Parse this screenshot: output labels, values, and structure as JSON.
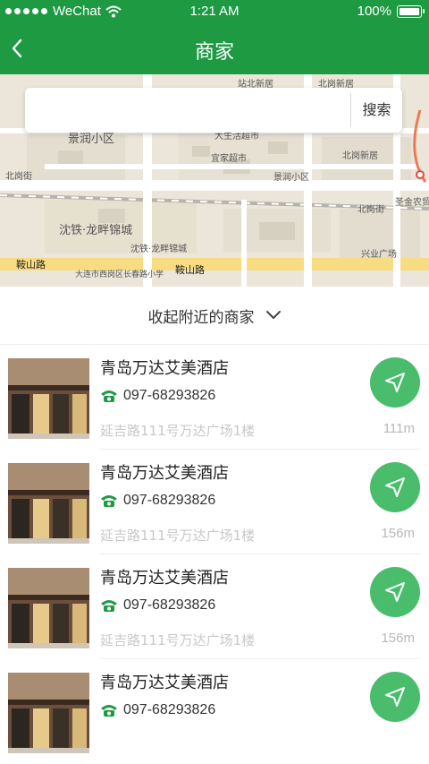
{
  "status": {
    "carrier": "WeChat",
    "time": "1:21 AM",
    "battery": "100%"
  },
  "nav": {
    "title": "商家",
    "back_icon": "chevron-left-icon"
  },
  "search": {
    "placeholder": "",
    "button": "搜索"
  },
  "map": {
    "labels": [
      "景润小区",
      "大生活超市",
      "宜家超市",
      "北岗街",
      "沈铁·龙畔锦城",
      "鞍山路",
      "大连市西岗区长春路小学",
      "景润小区",
      "北岗新居",
      "北岗街",
      "圣金农贸",
      "兴业广场",
      "沈铁·龙畔锦城",
      "鞍山路",
      "站北新居",
      "北岗新居"
    ]
  },
  "toggle": {
    "label": "收起附近的商家"
  },
  "stores": [
    {
      "name": "青岛万达艾美酒店",
      "phone": "097-68293826",
      "address": "延吉路111号万达广场1楼",
      "distance": "111m"
    },
    {
      "name": "青岛万达艾美酒店",
      "phone": "097-68293826",
      "address": "延吉路111号万达广场1楼",
      "distance": "156m"
    },
    {
      "name": "青岛万达艾美酒店",
      "phone": "097-68293826",
      "address": "延吉路111号万达广场1楼",
      "distance": "156m"
    },
    {
      "name": "青岛万达艾美酒店",
      "phone": "097-68293826",
      "address": "",
      "distance": ""
    }
  ],
  "colors": {
    "brand": "#1e9a43",
    "nav_button": "#49bd6c"
  }
}
